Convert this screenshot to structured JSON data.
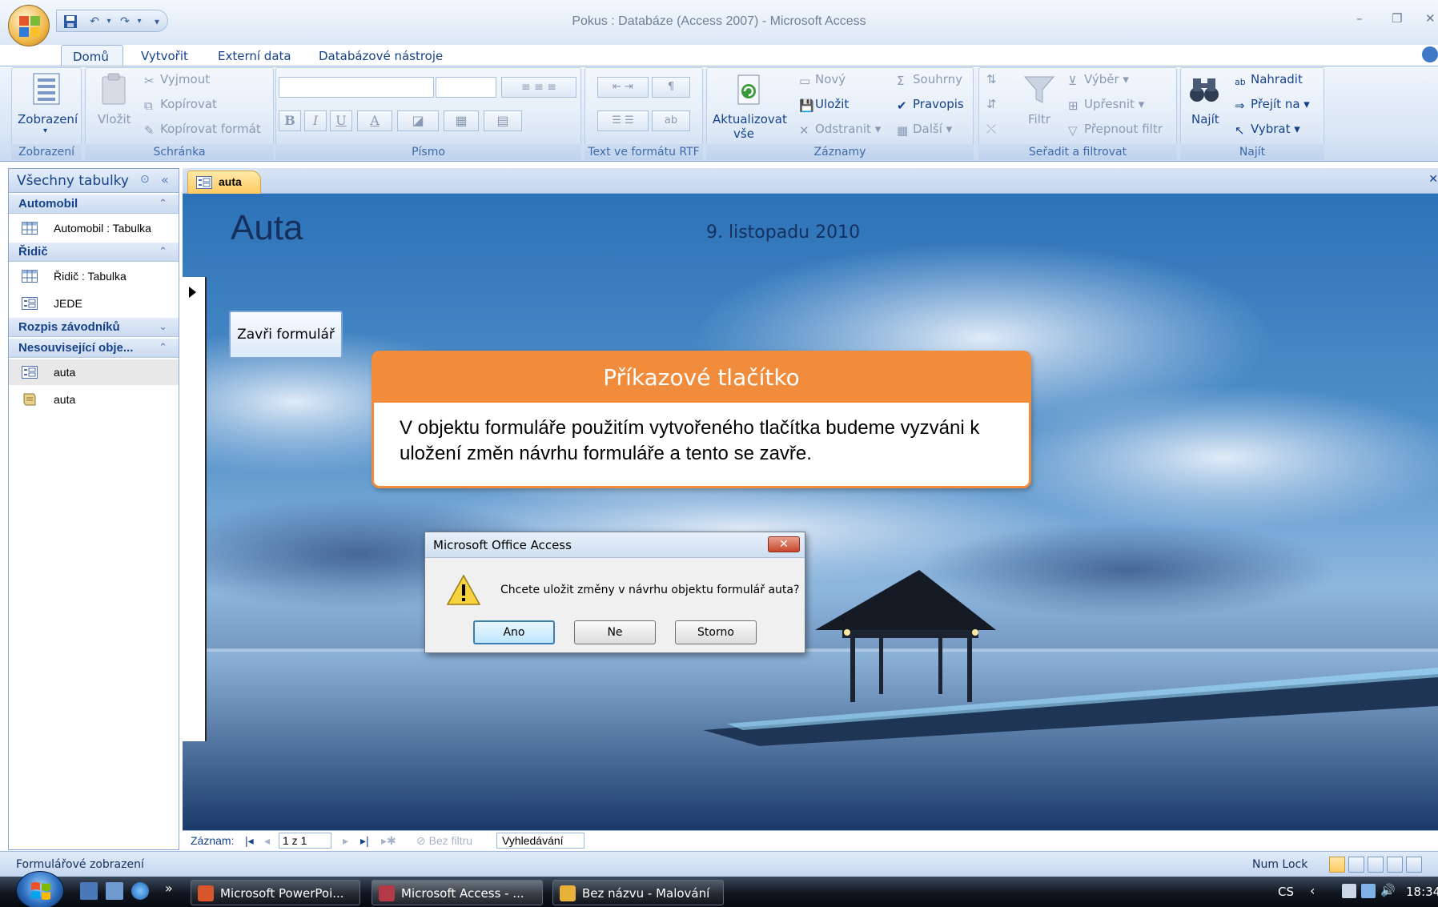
{
  "window": {
    "title": "Pokus : Databáze (Access 2007) - Microsoft Access"
  },
  "ribbon": {
    "tabs": [
      "Domů",
      "Vytvořit",
      "Externí data",
      "Databázové nástroje"
    ],
    "active_tab": "Domů",
    "groups": {
      "zobrazeni": {
        "label": "Zobrazení",
        "button": "Zobrazení"
      },
      "schranka": {
        "label": "Schránka",
        "paste": "Vložit",
        "cut": "Vyjmout",
        "copy": "Kopírovat",
        "format_painter": "Kopírovat formát"
      },
      "pismo": {
        "label": "Písmo",
        "bold": "B",
        "italic": "I",
        "underline": "U",
        "font_color": "A"
      },
      "rtf": {
        "label": "Text ve formátu RTF"
      },
      "zaznamy": {
        "label": "Záznamy",
        "refresh": "Aktualizovat",
        "refresh_line2": "vše",
        "new": "Nový",
        "save": "Uložit",
        "delete": "Odstranit",
        "totals": "Souhrny",
        "spelling": "Pravopis",
        "more": "Další"
      },
      "seradit": {
        "label": "Seřadit a filtrovat",
        "filter": "Filtr",
        "selection": "Výběr",
        "advanced": "Upřesnit",
        "toggle_filter": "Přepnout filtr"
      },
      "najit": {
        "label": "Najít",
        "find": "Najít",
        "replace": "Nahradit",
        "goto": "Přejít na",
        "select": "Vybrat"
      }
    }
  },
  "nav_pane": {
    "title": "Všechny tabulky",
    "groups": [
      {
        "label": "Automobil",
        "items": [
          {
            "label": "Automobil : Tabulka",
            "icon": "table-icon"
          }
        ]
      },
      {
        "label": "Řidič",
        "items": [
          {
            "label": "Řidič : Tabulka",
            "icon": "table-icon"
          },
          {
            "label": "JEDE",
            "icon": "form-icon"
          }
        ]
      },
      {
        "label": "Rozpis závodníků",
        "items": []
      },
      {
        "label": "Nesouvisející obje...",
        "items": [
          {
            "label": "auta",
            "icon": "form-icon",
            "selected": true
          },
          {
            "label": "auta",
            "icon": "report-icon"
          }
        ]
      }
    ]
  },
  "document": {
    "tab_label": "auta",
    "form_title": "Auta",
    "form_date": "9. listopadu 2010",
    "close_button_label": "Zavři formulář"
  },
  "callout": {
    "title": "Příkazové tlačítko",
    "body": "V objektu formuláře použitím vytvořeného tlačítka budeme vyzváni k uložení změn návrhu formuláře a tento se zavře."
  },
  "dialog": {
    "title": "Microsoft Office Access",
    "message": "Chcete uložit změny v návrhu objektu formulář auta?",
    "buttons": {
      "yes": "Ano",
      "no": "Ne",
      "cancel": "Storno"
    }
  },
  "record_nav": {
    "label": "Záznam:",
    "position": "1 z 1",
    "filter": "Bez filtru",
    "search": "Vyhledávání"
  },
  "status": {
    "left": "Formulářové zobrazení",
    "numlock": "Num Lock"
  },
  "taskbar": {
    "tasks": [
      {
        "label": "Microsoft PowerPoi...",
        "color": "#d9552c"
      },
      {
        "label": "Microsoft Access - ...",
        "color": "#b23a48"
      },
      {
        "label": "Bez názvu - Malování",
        "color": "#e8b23a"
      }
    ],
    "language": "CS",
    "time": "18:34"
  },
  "colors": {
    "callout_accent": "#f08c3c",
    "ribbon_text": "#15428b",
    "active_tab": "#ffc861"
  }
}
